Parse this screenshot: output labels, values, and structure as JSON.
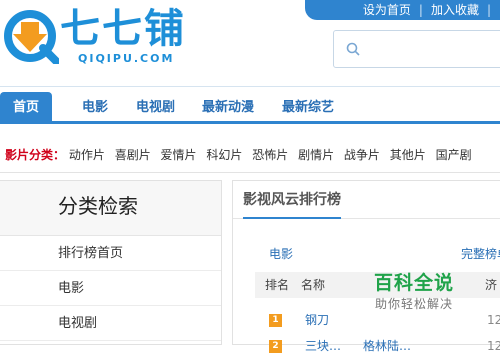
{
  "brand": {
    "logo_text": "七七铺",
    "logo_sub": "QIQIPU.COM",
    "colors": {
      "primary": "#2f84cf",
      "accent_orange": "#f39c1f",
      "category_label": "#d0021b"
    }
  },
  "top_links": {
    "set_home": "设为首页",
    "separator": "|",
    "bookmark": "加入收藏",
    "more": "|"
  },
  "search": {
    "placeholder": "",
    "icon": "search-icon"
  },
  "nav": {
    "items": [
      {
        "label": "首页",
        "active": true
      },
      {
        "label": "电影"
      },
      {
        "label": "电视剧"
      },
      {
        "label": "最新动漫"
      },
      {
        "label": "最新综艺"
      }
    ]
  },
  "categories": {
    "label": "影片分类：",
    "items": [
      "动作片",
      "喜剧片",
      "爱情片",
      "科幻片",
      "恐怖片",
      "剧情片",
      "战争片",
      "其他片",
      "国产剧"
    ]
  },
  "left_panel": {
    "title": "分类检索",
    "items": [
      "排行榜首页",
      "电影",
      "电视剧"
    ]
  },
  "right_panel": {
    "title": "影视风云排行榜",
    "section": "电影",
    "full_list": "完整榜单",
    "columns": [
      "排名",
      "名称",
      "济"
    ],
    "rows": [
      {
        "rank": "1",
        "name": "钢刀",
        "extra": "",
        "num": "12"
      },
      {
        "rank": "2",
        "name": "三块…",
        "extra": "格林陆…",
        "num": "12"
      }
    ]
  },
  "watermark": {
    "title": "百科全说",
    "subtitle": "助你轻松解决"
  }
}
